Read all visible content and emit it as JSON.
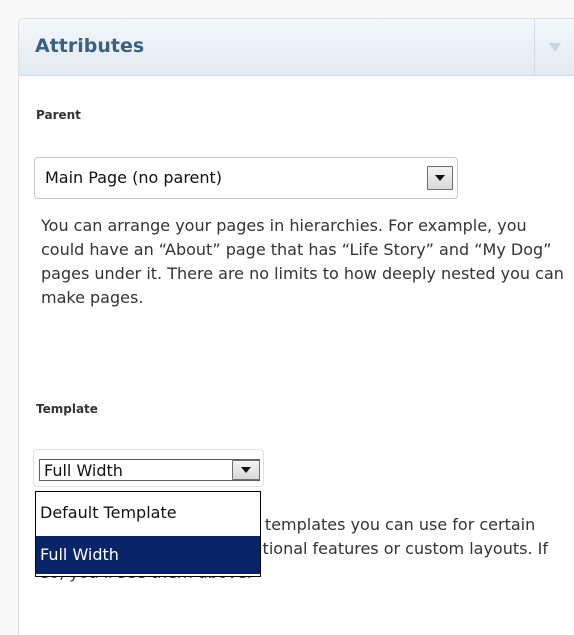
{
  "panel": {
    "title": "Attributes",
    "collapse_icon": "triangle-down-icon"
  },
  "parent": {
    "label": "Parent",
    "selected": "Main Page (no parent)",
    "help": "You can arrange your pages in hierarchies. For example, you could have an “About” page that has “Life Story” and “My Dog” pages under it. There are no limits to how deeply nested you can make pages."
  },
  "template": {
    "label": "Template",
    "selected": "Full Width",
    "options": [
      "Default Template",
      "Full Width"
    ],
    "selected_option_index": 1,
    "help": "Some themes have custom templates you can use for certain pages that might have additional features or custom layouts. If so, you’ll see them above."
  },
  "colors": {
    "title": "#3d5f80",
    "selection_highlight": "#0a246a"
  }
}
